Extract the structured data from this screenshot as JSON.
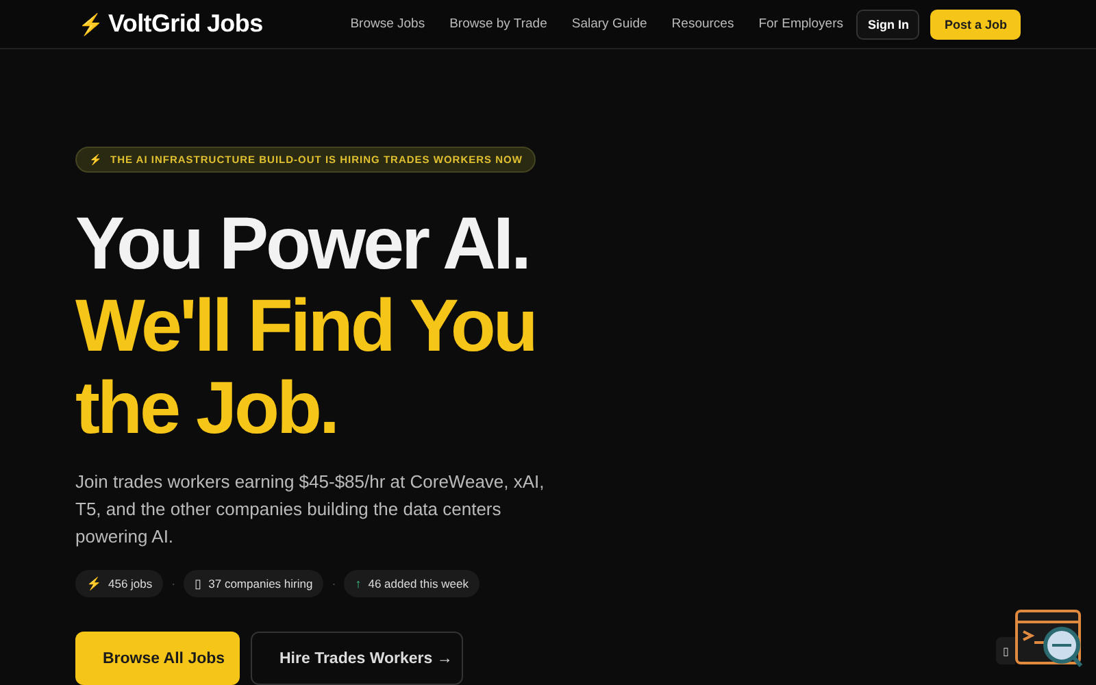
{
  "nav": {
    "logo_icon": "⚡",
    "logo": "VoltGrid Jobs",
    "links": [
      {
        "label": "Browse Jobs"
      },
      {
        "label": "Browse by Trade"
      },
      {
        "label": "Salary Guide"
      },
      {
        "label": "Resources"
      },
      {
        "label": "For Employers"
      }
    ],
    "sign_in": "Sign In",
    "post_job": "Post a Job"
  },
  "hero": {
    "badge_icon": "⚡",
    "badge": "THE AI INFRASTRUCTURE BUILD-OUT IS HIRING TRADES WORKERS NOW",
    "headline": [
      {
        "text": "You Power AI.",
        "kind": "plain"
      },
      {
        "text": "We'll Find You",
        "kind": "accent"
      },
      {
        "text": "the Job.",
        "kind": "accent"
      }
    ],
    "subtitle": "Join trades workers earning $45-$85/hr at CoreWeave, xAI, T5, and the other companies building the data centers powering AI.",
    "stats": [
      {
        "icon": "⚡",
        "text": "456 jobs",
        "kind": "bolt"
      },
      {
        "icon": "▯",
        "text": "37 companies hiring",
        "kind": "plain"
      },
      {
        "icon": "↑",
        "text": "46 added this week",
        "kind": "up"
      }
    ],
    "separator": "·",
    "buttons": [
      {
        "label": "Browse All Jobs",
        "kind": "primary"
      },
      {
        "label": "Hire Trades Workers →",
        "kind": "secondary"
      }
    ]
  },
  "widget": {
    "icon": "▯"
  }
}
